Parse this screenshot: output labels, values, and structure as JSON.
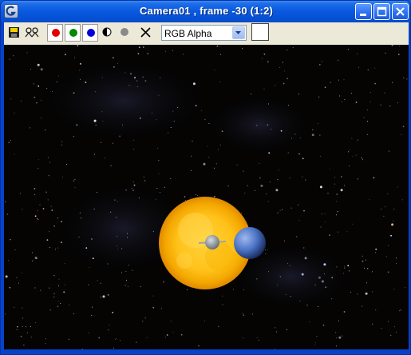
{
  "window": {
    "title": "Camera01 , frame -30 (1:2)",
    "controls": [
      "minimize-icon",
      "maximize-icon",
      "close-icon"
    ]
  },
  "toolbar": {
    "tools": [
      "save-icon",
      "clone-icon",
      "red-channel",
      "green-channel",
      "blue-channel",
      "monochrome-icon",
      "alpha-channel",
      "clear-icon"
    ],
    "channel_select": "RGB Alpha",
    "swatch_color": "#ffffff"
  },
  "scene": {
    "background": "#000000",
    "sun_color": "#ffc21a",
    "planet_color": "#4a72c4"
  },
  "colors": {
    "titlebar": "#0a5ae0",
    "toolbar": "#ece9d8",
    "red": "#e00000",
    "green": "#008a00",
    "blue": "#0000d8"
  }
}
